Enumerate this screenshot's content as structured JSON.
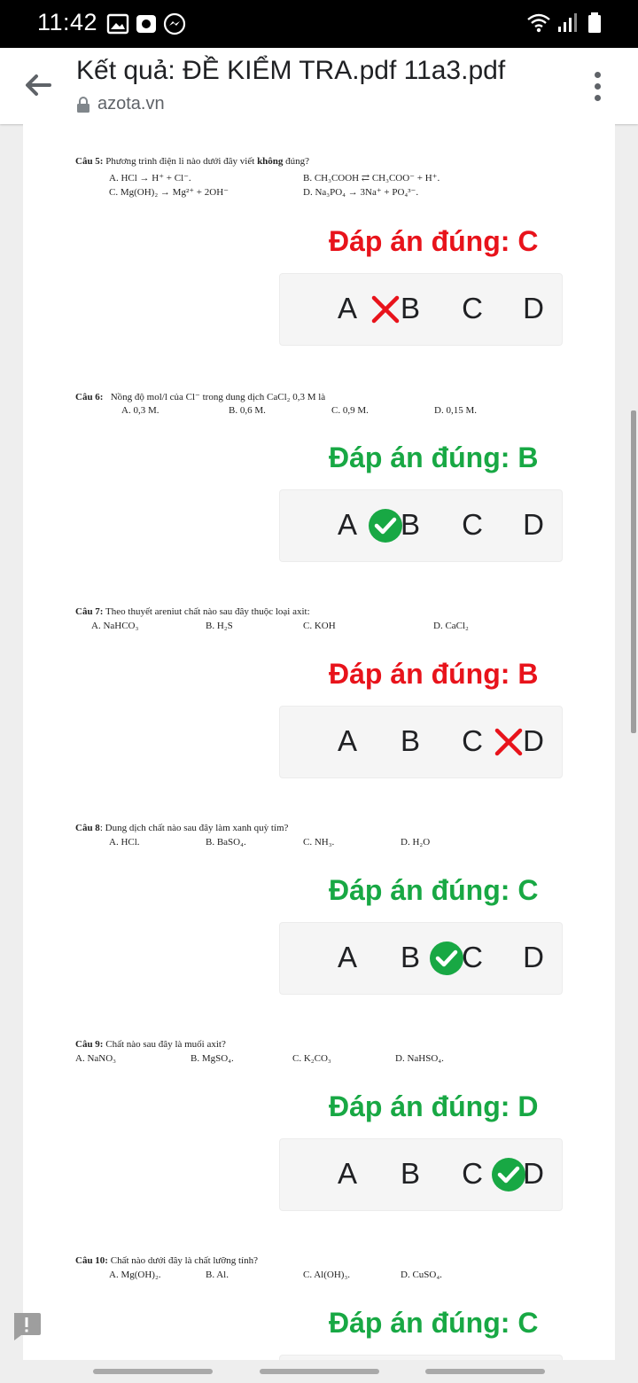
{
  "status_bar": {
    "time": "11:42",
    "icons": [
      "image-icon",
      "camera-app-icon",
      "messenger-icon",
      "wifi-icon",
      "signal-icon",
      "battery-icon"
    ]
  },
  "app_bar": {
    "title": "Kết quả: ĐỀ KIỂM TRA.pdf 11a3.pdf",
    "url": "azota.vn"
  },
  "questions": [
    {
      "label": "Câu 5:",
      "stem": "Phương trình điện li nào dưới đây viết",
      "stem_emphasis": "không",
      "stem_end": "đúng?",
      "options": [
        "A. HCl → H⁺ + Cl⁻.",
        "B. CH₃COOH ⇄ CH₃COO⁻ + H⁺.",
        "C. Mg(OH)₂ → Mg²⁺ + 2OH⁻",
        "D. Na₃PO₄ → 3Na⁺ + PO₄³⁻."
      ],
      "answer_text": "Đáp án đúng: C",
      "correct": false
    },
    {
      "label": "Câu 6:",
      "stem": "Nồng độ mol/l của Cl⁻ trong dung dịch CaCl₂ 0,3 M là",
      "options": [
        "A. 0,3 M.",
        "B. 0,6 M.",
        "C. 0,9 M.",
        "D. 0,15 M."
      ],
      "answer_text": "Đáp án đúng: B",
      "correct": true
    },
    {
      "label": "Câu 7:",
      "stem": "Theo thuyết areniut chất nào sau đây thuộc loại axit:",
      "options": [
        "A.  NaHCO₃",
        "B. H₂S",
        "C. KOH",
        "D. CaCl₂"
      ],
      "answer_text": "Đáp án đúng: B",
      "correct": false
    },
    {
      "label": "Câu 8",
      "stem": ": Dung dịch chất nào sau đây làm xanh quỳ tím?",
      "options": [
        "A. HCl.",
        "B. BaSO₄.",
        "C. NH₃.",
        "D.  H₂O"
      ],
      "answer_text": "Đáp án đúng: C",
      "correct": true
    },
    {
      "label": "Câu 9:",
      "stem": "Chất nào sau đây là muối axit?",
      "options": [
        "A. NaNO₃",
        "B. MgSO₄.",
        "C. K₂CO₃",
        "D. NaHSO₄."
      ],
      "answer_text": "Đáp án đúng: D",
      "correct": true
    },
    {
      "label": "Câu 10:",
      "stem": "Chất nào dưới đây là chất lưỡng tính?",
      "options": [
        "A. Mg(OH)₂.",
        "B. Al.",
        "C. Al(OH)₃.",
        "D. CuSO₄."
      ],
      "answer_text": "Đáp án đúng: C",
      "correct": true
    }
  ],
  "choice_letters": [
    "A",
    "B",
    "C",
    "D"
  ],
  "colors": {
    "wrong": "#e8131b",
    "right": "#18a844"
  }
}
